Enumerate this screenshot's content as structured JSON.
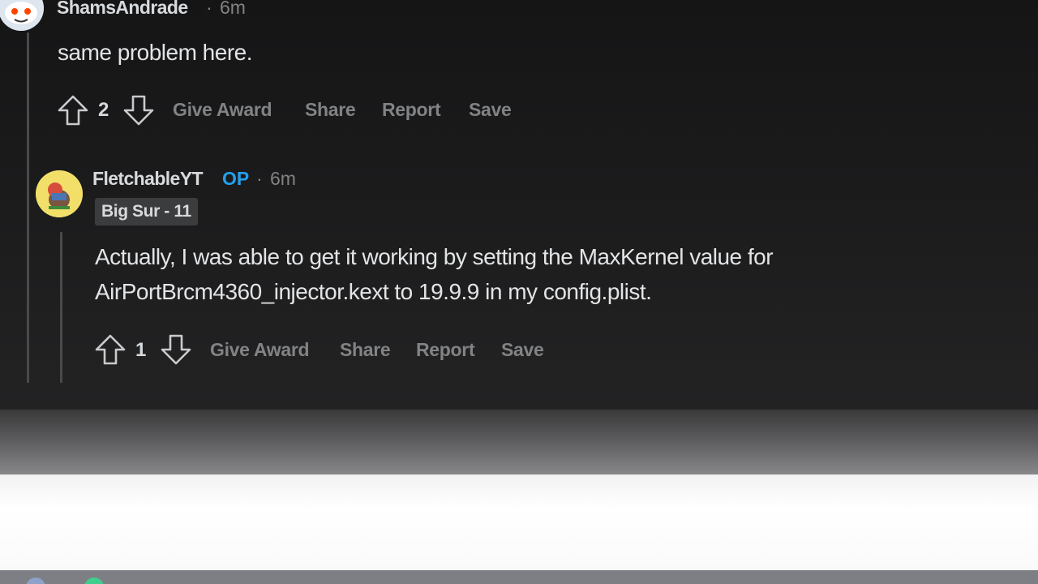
{
  "comments": [
    {
      "author": "ShamsAndrade",
      "time": "6m",
      "text": "same problem here.",
      "votes": "2",
      "actions": {
        "award": "Give Award",
        "share": "Share",
        "report": "Report",
        "save": "Save"
      }
    },
    {
      "author": "FletchableYT",
      "badge": "OP",
      "time": "6m",
      "flair": "Big Sur - 11",
      "text_lines": [
        "Actually, I was able to get it working by setting the MaxKernel value for",
        "AirPortBrcm4360_injector.kext to 19.9.9 in my config.plist."
      ],
      "votes": "1",
      "actions": {
        "award": "Give Award",
        "share": "Share",
        "report": "Report",
        "save": "Save"
      }
    }
  ],
  "separator": "·",
  "colors": {
    "background": "#1a1a1b",
    "text": "#d7dadc",
    "muted": "#818384",
    "op_blue": "#24a0ed",
    "flair_bg": "#3b3c3d"
  },
  "icons": [
    "upvote-arrow-icon",
    "downvote-arrow-icon",
    "avatar-icon"
  ]
}
